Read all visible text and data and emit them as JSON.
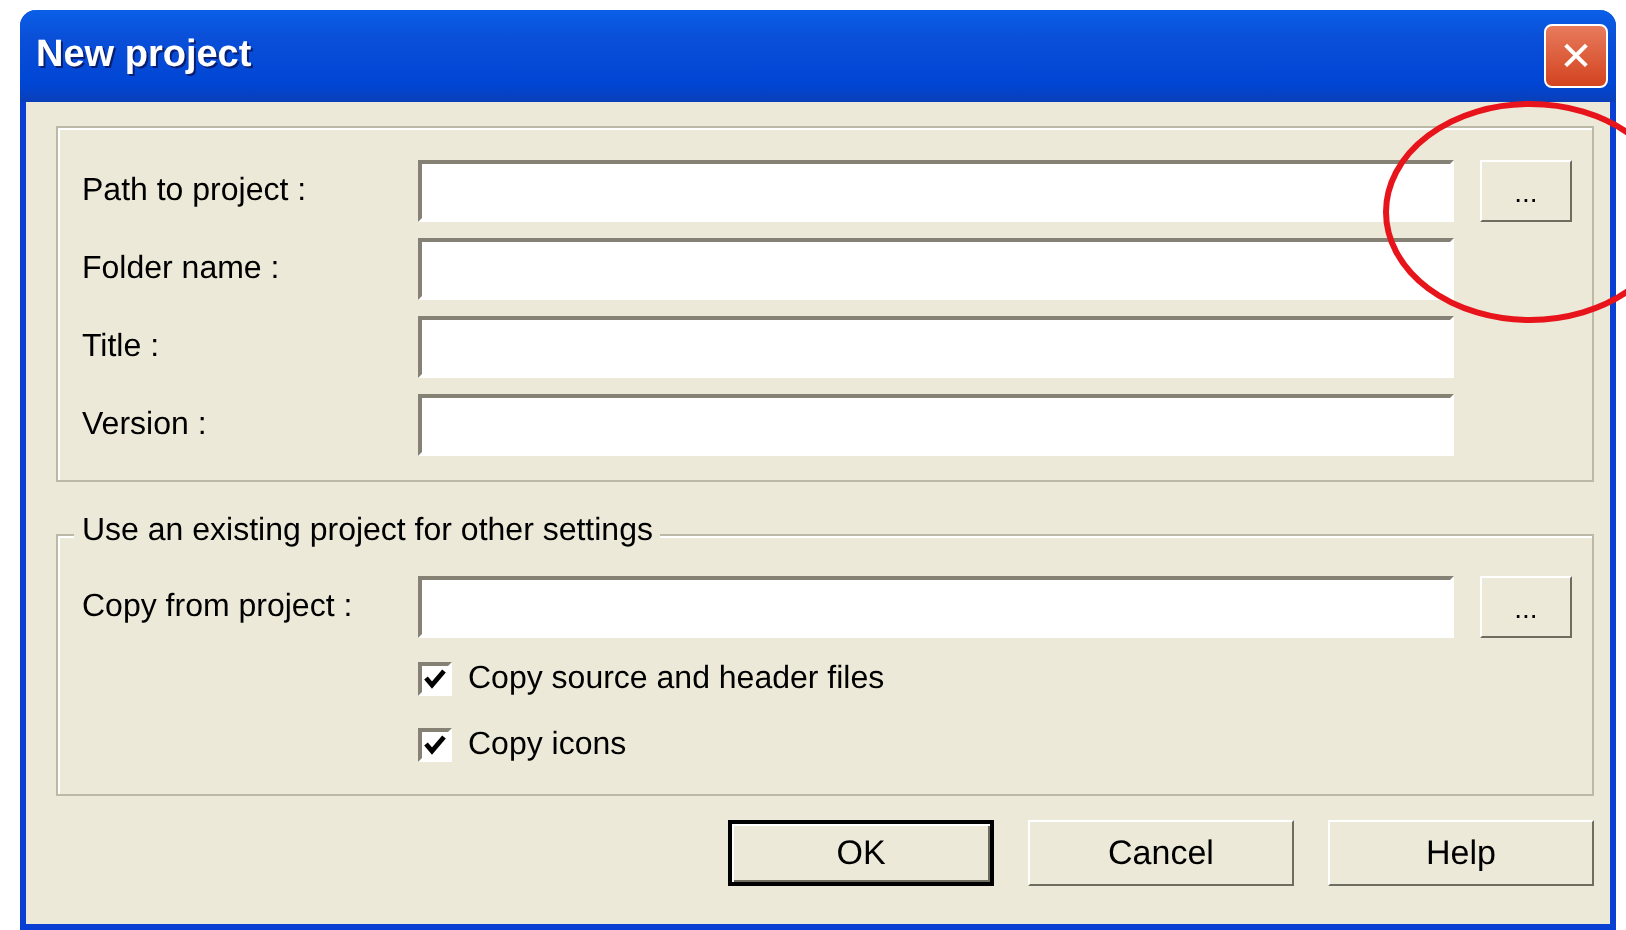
{
  "window": {
    "title": "New project",
    "close_icon": "✕"
  },
  "fields": [
    {
      "label": "Path to project :",
      "browse": "..."
    },
    {
      "label": "Folder name :"
    },
    {
      "label": "Title :"
    },
    {
      "label": "Version :"
    }
  ],
  "existing_group": {
    "legend": "Use an existing project for other settings",
    "field": {
      "label": "Copy from project :",
      "browse": "..."
    },
    "checkboxes": [
      {
        "label": "Copy source and header files",
        "checked": true
      },
      {
        "label": "Copy icons",
        "checked": true
      }
    ]
  },
  "buttons": [
    {
      "label": "OK",
      "default": true
    },
    {
      "label": "Cancel",
      "default": false
    },
    {
      "label": "Help",
      "default": false
    }
  ]
}
